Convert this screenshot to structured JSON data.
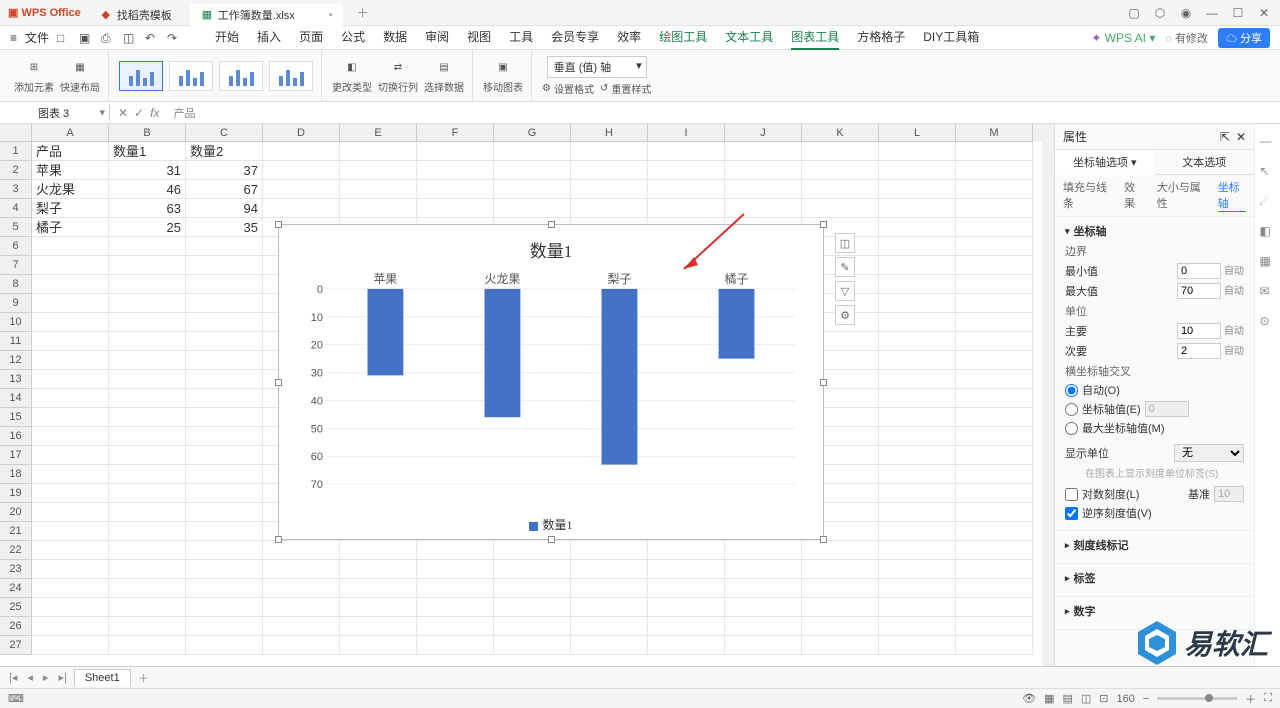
{
  "titlebar": {
    "app": "WPS Office",
    "tab1": "找稻壳模板",
    "tab2": "工作簿数量.xlsx"
  },
  "menu": {
    "file": "文件",
    "tabs": [
      "开始",
      "插入",
      "页面",
      "公式",
      "数据",
      "审阅",
      "视图",
      "工具",
      "会员专享",
      "效率",
      "绘图工具",
      "文本工具",
      "图表工具",
      "方格格子",
      "DIY工具箱"
    ],
    "ai": "WPS AI",
    "modified": "有修改",
    "share": "分享"
  },
  "ribbon": {
    "add_element": "添加元素",
    "quick_layout": "快速布局",
    "change_type": "更改类型",
    "switch_rowcol": "切换行列",
    "select_data": "选择数据",
    "move_chart": "移动图表",
    "axis_select": "垂直 (值) 轴",
    "set_format": "设置格式",
    "reset_style": "重置样式"
  },
  "namebox": "图表 3",
  "formula": "产品",
  "columns": [
    "A",
    "B",
    "C",
    "D",
    "E",
    "F",
    "G",
    "H",
    "I",
    "J",
    "K",
    "L",
    "M"
  ],
  "rows_count": 27,
  "cells": {
    "A1": "产品",
    "B1": "数量1",
    "C1": "数量2",
    "A2": "苹果",
    "B2": "31",
    "C2": "37",
    "A3": "火龙果",
    "B3": "46",
    "C3": "67",
    "A4": "梨子",
    "B4": "63",
    "C4": "94",
    "A5": "橘子",
    "B5": "25",
    "C5": "35"
  },
  "chart_data": {
    "type": "bar",
    "title": "数量1",
    "categories": [
      "苹果",
      "火龙果",
      "梨子",
      "橘子"
    ],
    "values": [
      31,
      46,
      63,
      25
    ],
    "ylabel": "",
    "xlabel": "",
    "ylim": [
      0,
      70
    ],
    "y_ticks": [
      0,
      10,
      20,
      30,
      40,
      50,
      60,
      70
    ],
    "reversed_y": true,
    "legend": [
      "数量1"
    ],
    "series_color": "#4472c4"
  },
  "props": {
    "title": "属性",
    "tab_axis": "坐标轴选项",
    "tab_text": "文本选项",
    "subtabs": [
      "填充与线条",
      "效果",
      "大小与属性",
      "坐标轴"
    ],
    "section_axis": "坐标轴",
    "bound": "边界",
    "min": "最小值",
    "min_v": "0",
    "max": "最大值",
    "max_v": "70",
    "unit": "单位",
    "major": "主要",
    "major_v": "10",
    "minor": "次要",
    "minor_v": "2",
    "auto": "自动",
    "cross": "横坐标轴交叉",
    "cross_auto": "自动(O)",
    "cross_val": "坐标轴值(E)",
    "cross_val_v": "0",
    "cross_max": "最大坐标轴值(M)",
    "display_unit": "显示单位",
    "display_unit_v": "无",
    "display_hint": "在图表上显示刻度单位标签(S)",
    "log": "对数刻度(L)",
    "base": "基准",
    "base_v": "10",
    "reverse": "逆序刻度值(V)",
    "ticks": "刻度线标记",
    "labels": "标签",
    "numbers": "数字"
  },
  "sheet": {
    "name": "Sheet1"
  },
  "status": {
    "zoom": "160"
  },
  "watermark": "易软汇"
}
